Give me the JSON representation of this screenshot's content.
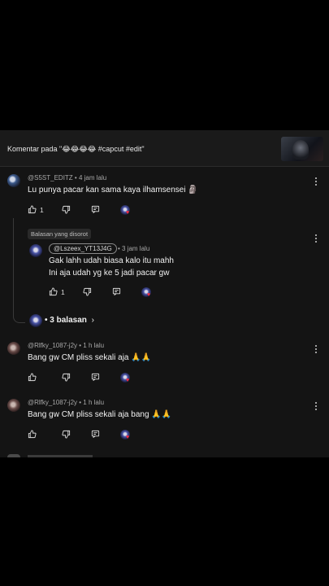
{
  "header": {
    "title": "Komentar pada \"😂😂😂😂 #capcut #edit\""
  },
  "comments": [
    {
      "handle": "@S5ST_EDITZ",
      "time": "• 4 jam lalu",
      "text": "Lu punya pacar kan sama kaya ilhamsensei 🗿",
      "likes": "1"
    },
    {
      "handle": "@Rlfky_1087-j2y",
      "time": "• 1 h lalu",
      "text": "Bang gw CM pliss sekali aja 🙏🙏",
      "likes": ""
    },
    {
      "handle": "@Rlfky_1087-j2y",
      "time": "• 1 h lalu",
      "text": "Bang gw CM pliss sekali aja bang 🙏🙏",
      "likes": ""
    }
  ],
  "reply": {
    "tag": "Balasan yang disorot",
    "mention": "@Lszeex_YT13J4G",
    "time": "• 3 jam lalu",
    "line1": "Gak lahh udah biasa kalo itu mahh",
    "line2": "Ini aja udah yg ke 5 jadi pacar gw",
    "likes": "1"
  },
  "more_replies": {
    "label": "• 3 balasan",
    "chevron": "›"
  },
  "icons": {
    "like": "thumbs-up-icon",
    "dislike": "thumbs-down-icon",
    "reply": "reply-comment-icon",
    "more": "more-vertical-icon",
    "heart": "creator-heart-icon"
  }
}
